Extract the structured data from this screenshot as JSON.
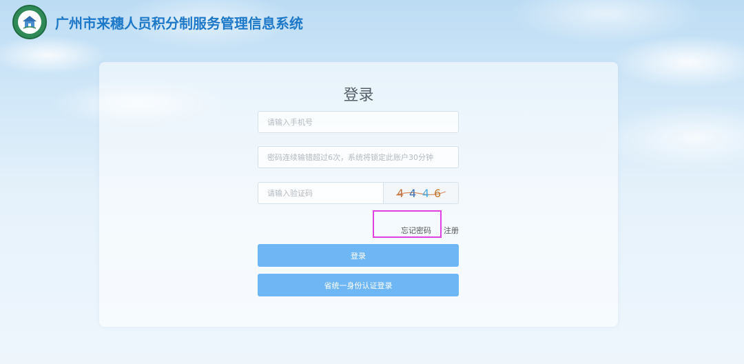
{
  "header": {
    "title": "广州市来穗人员积分制服务管理信息系统",
    "logo_icon": "emblem-logo-icon"
  },
  "login": {
    "title": "登录",
    "phone_placeholder": "请输入手机号",
    "password_placeholder": "密码连续输错超过6次，系统将锁定此账户30分钟",
    "captcha_placeholder": "请输入验证码",
    "captcha_digits": [
      "4",
      "4",
      "4",
      "6"
    ],
    "forgot_password": "忘记密码",
    "register": "注册",
    "login_button": "登录",
    "sso_button": "省统一身份认证登录"
  },
  "colors": {
    "title_blue": "#1e78c8",
    "button_blue": "#6fb6f5",
    "highlight": "#e040e0"
  }
}
